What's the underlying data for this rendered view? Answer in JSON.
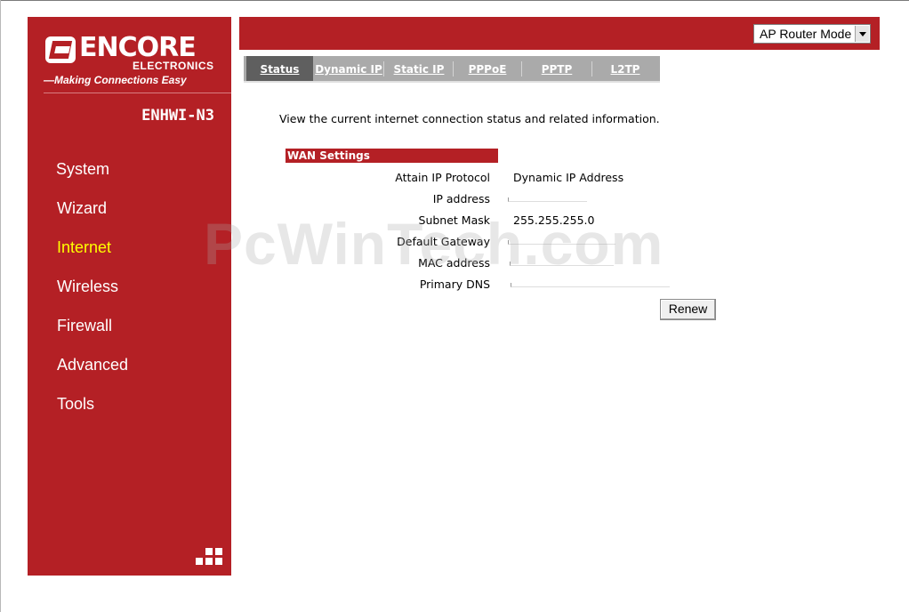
{
  "brand": {
    "name": "ENCORE",
    "sub": "ELECTRONICS",
    "tagline": "—Making Connections Easy",
    "model": "ENHWI-N3"
  },
  "sidebar": {
    "items": [
      {
        "label": "System"
      },
      {
        "label": "Wizard"
      },
      {
        "label": "Internet"
      },
      {
        "label": "Wireless"
      },
      {
        "label": "Firewall"
      },
      {
        "label": "Advanced"
      },
      {
        "label": "Tools"
      }
    ],
    "active_index": 2
  },
  "mode_select": {
    "value": "AP Router Mode"
  },
  "tabs": [
    {
      "label": "Status"
    },
    {
      "label": "Dynamic IP"
    },
    {
      "label": "Static IP"
    },
    {
      "label": "PPPoE"
    },
    {
      "label": "PPTP"
    },
    {
      "label": "L2TP"
    }
  ],
  "intro": "View the current internet connection status and related information.",
  "wan": {
    "heading": "WAN Settings",
    "rows": [
      {
        "label": "Attain IP Protocol",
        "value": "Dynamic IP Address"
      },
      {
        "label": "IP address",
        "value": ""
      },
      {
        "label": "Subnet Mask",
        "value": "255.255.255.0"
      },
      {
        "label": "Default Gateway",
        "value": ""
      },
      {
        "label": "MAC address",
        "value": ""
      },
      {
        "label": "Primary DNS",
        "value": ""
      }
    ]
  },
  "renew_label": "Renew",
  "watermark": "PcWinTech.com",
  "colors": {
    "brand_red": "#b42025",
    "active_nav": "#ffff00",
    "tab_bg": "#aaaaaa",
    "tab_active": "#5f5f5f"
  },
  "icons": [
    "router-mode-dropdown-icon",
    "grid-icon"
  ]
}
